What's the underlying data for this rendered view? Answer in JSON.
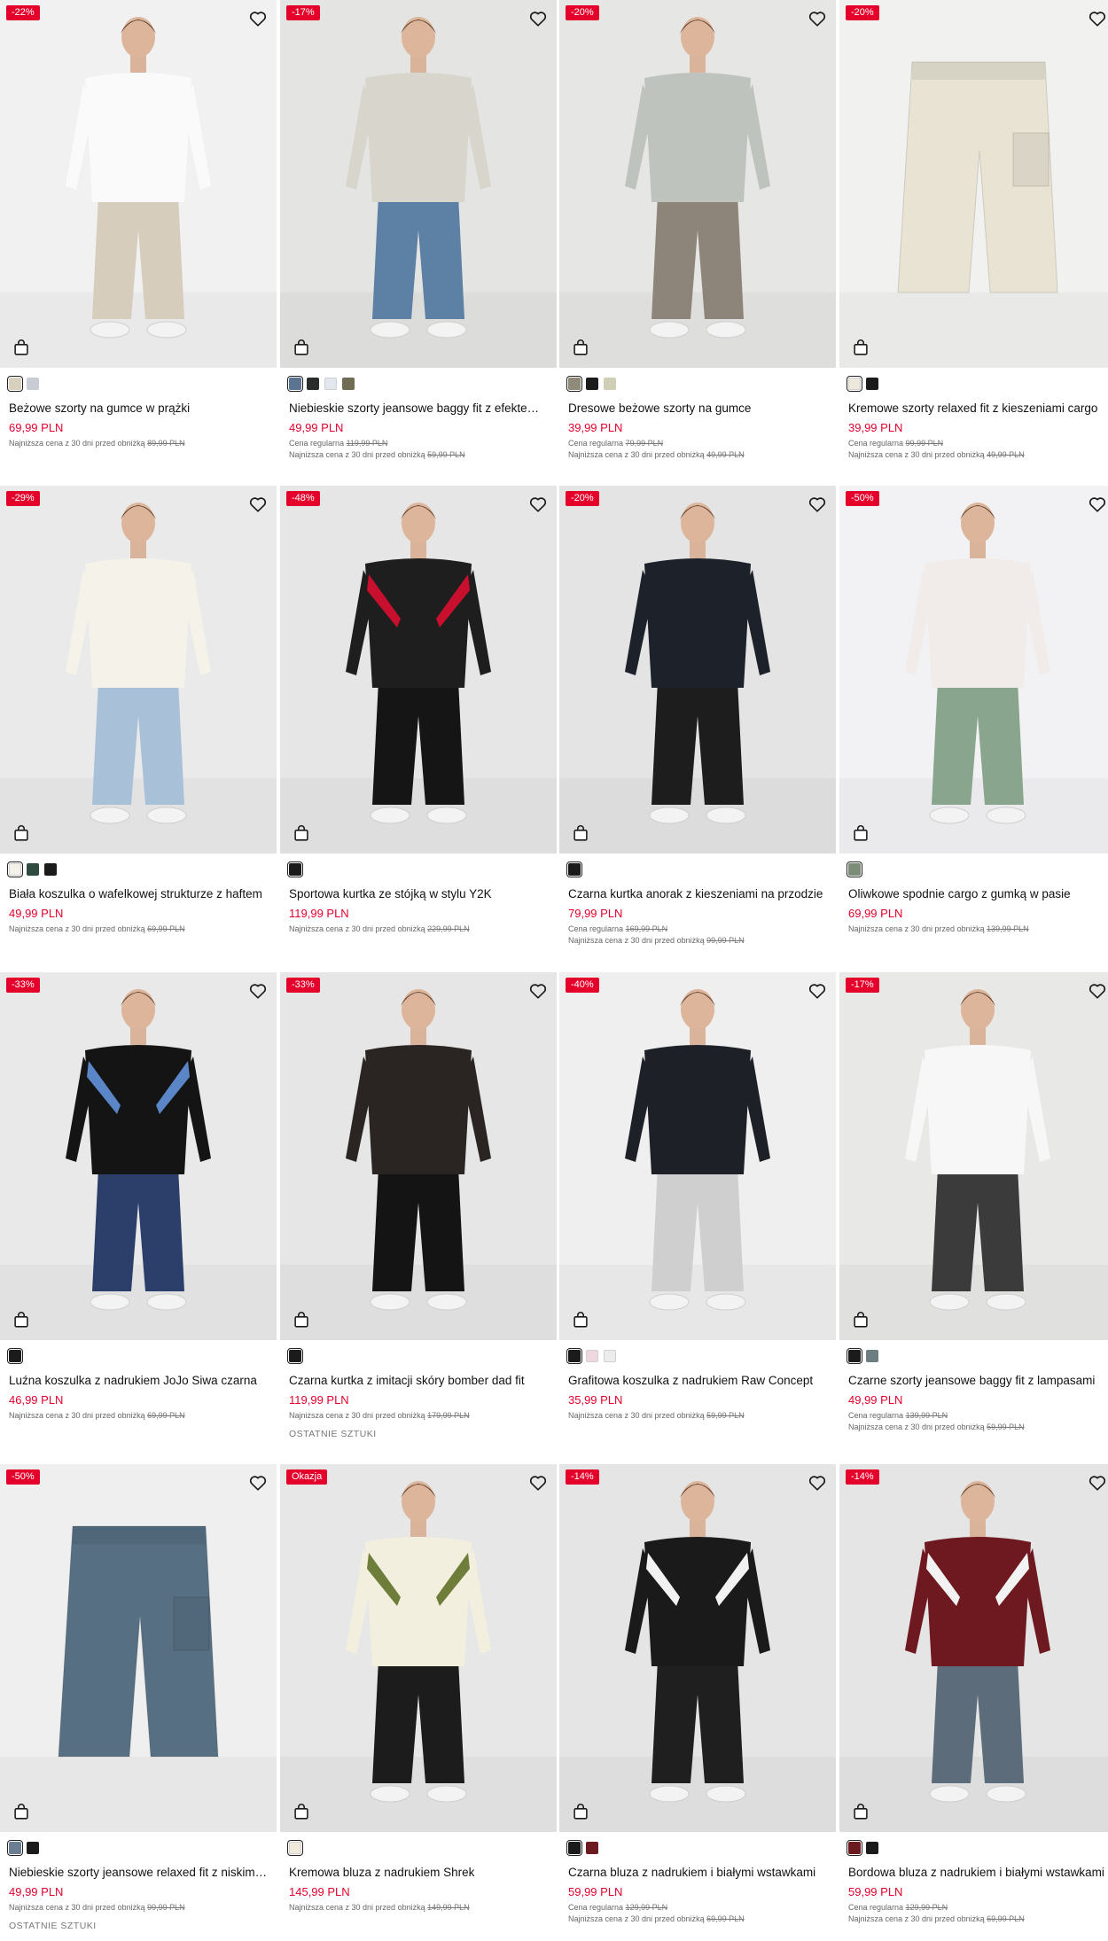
{
  "labels": {
    "lowest_price_prefix": "Najniższa cena z 30 dni przed obniżką",
    "regular_price_prefix": "Cena regularna",
    "last_items": "OSTATNIE SZTUKI"
  },
  "icons": {
    "favorite": "heart-icon",
    "add_to_bag": "shopping-bag-icon"
  },
  "colors": {
    "badge": "#e4002b",
    "price": "#e4002b"
  },
  "products": [
    {
      "badge": "-22%",
      "name": "Beżowe szorty na gumce w prążki",
      "price": "69,99 PLN",
      "regular": null,
      "lowest": "89,99 PLN",
      "last": false,
      "swatches": [
        "#d8cfbd",
        "#c9ccd3"
      ],
      "photo": {
        "bg": "#f1f1f1",
        "top": "#fafafa",
        "bottom": "#d7cdbd",
        "type": "person"
      }
    },
    {
      "badge": "-17%",
      "name": "Niebieskie szorty jeansowe baggy fit z efektem sprania",
      "price": "49,99 PLN",
      "regular": "119,99 PLN",
      "lowest": "59,99 PLN",
      "last": false,
      "swatches": [
        "#5b7590",
        "#2b2d2c",
        "#e2e8ed",
        "#6e6c52"
      ],
      "photo": {
        "bg": "#e4e4e2",
        "top": "#d8d6cc",
        "bottom": "#5d80a5",
        "type": "person"
      }
    },
    {
      "badge": "-20%",
      "name": "Dresowe beżowe szorty na gumce",
      "price": "39,99 PLN",
      "regular": "79,99 PLN",
      "lowest": "49,99 PLN",
      "last": false,
      "swatches": [
        "#8f8a7a",
        "#1b1b1b",
        "#cfcfb5"
      ],
      "photo": {
        "bg": "#e6e6e4",
        "top": "#bfc3bd",
        "bottom": "#8e857a",
        "type": "person"
      }
    },
    {
      "badge": "-20%",
      "name": "Kremowe szorty relaxed fit z kieszeniami cargo",
      "price": "39,99 PLN",
      "regular": "99,99 PLN",
      "lowest": "49,99 PLN",
      "last": false,
      "swatches": [
        "#ece8dc",
        "#1b1b1b"
      ],
      "photo": {
        "bg": "#f1f1ef",
        "top": null,
        "bottom": "#e8e3d3",
        "type": "shorts"
      }
    },
    {
      "badge": "-29%",
      "name": "Biała koszulka o wafelkowej strukturze z haftem",
      "price": "49,99 PLN",
      "regular": null,
      "lowest": "69,99 PLN",
      "last": false,
      "swatches": [
        "#f4f1ea",
        "#2f4b40",
        "#1b1b1b"
      ],
      "photo": {
        "bg": "#eaeaea",
        "top": "#f5f2ea",
        "bottom": "#a9c1d8",
        "type": "person"
      }
    },
    {
      "badge": "-48%",
      "name": "Sportowa kurtka ze stójką w stylu Y2K",
      "price": "119,99 PLN",
      "regular": null,
      "lowest": "229,99 PLN",
      "last": false,
      "swatches": [
        "#1b1b1b"
      ],
      "photo": {
        "bg": "#e6e6e6",
        "top": "#1e1e1e",
        "bottom": "#151515",
        "type": "person",
        "accent": "#c8102e"
      }
    },
    {
      "badge": "-20%",
      "name": "Czarna kurtka anorak z kieszeniami na przodzie",
      "price": "79,99 PLN",
      "regular": "169,99 PLN",
      "lowest": "99,99 PLN",
      "last": false,
      "swatches": [
        "#1b1b1b"
      ],
      "photo": {
        "bg": "#e4e4e4",
        "top": "#1c212a",
        "bottom": "#1d1d1d",
        "type": "person"
      }
    },
    {
      "badge": "-50%",
      "name": "Oliwkowe spodnie cargo z gumką w pasie",
      "price": "69,99 PLN",
      "regular": null,
      "lowest": "139,99 PLN",
      "last": false,
      "swatches": [
        "#7d8c78"
      ],
      "photo": {
        "bg": "#f2f2f4",
        "top": "#f1ecea",
        "bottom": "#8aa58e",
        "type": "person"
      }
    },
    {
      "badge": "-33%",
      "name": "Luźna koszulka z nadrukiem JoJo Siwa czarna",
      "price": "46,99 PLN",
      "regular": null,
      "lowest": "69,99 PLN",
      "last": false,
      "swatches": [
        "#1b1b1b"
      ],
      "photo": {
        "bg": "#e9e9e9",
        "top": "#141414",
        "bottom": "#2c3f6a",
        "type": "person",
        "accent": "#5a86c8"
      }
    },
    {
      "badge": "-33%",
      "name": "Czarna kurtka z imitacji skóry bomber dad fit",
      "price": "119,99 PLN",
      "regular": null,
      "lowest": "179,99 PLN",
      "last": true,
      "swatches": [
        "#1b1b1b"
      ],
      "photo": {
        "bg": "#e6e6e6",
        "top": "#2a2522",
        "bottom": "#141414",
        "type": "person"
      }
    },
    {
      "badge": "-40%",
      "name": "Grafitowa koszulka z nadrukiem Raw Concept",
      "price": "35,99 PLN",
      "regular": null,
      "lowest": "59,99 PLN",
      "last": false,
      "swatches": [
        "#1b1b1b",
        "#f0d6df",
        "#ececec"
      ],
      "photo": {
        "bg": "#efefef",
        "top": "#1d2027",
        "bottom": "#cfcfcf",
        "type": "person"
      }
    },
    {
      "badge": "-17%",
      "name": "Czarne szorty jeansowe baggy fit z lampasami",
      "price": "49,99 PLN",
      "regular": "139,99 PLN",
      "lowest": "59,99 PLN",
      "last": false,
      "swatches": [
        "#1b1b1b",
        "#6d7e80"
      ],
      "photo": {
        "bg": "#e8e8e6",
        "top": "#f7f7f7",
        "bottom": "#3b3b3b",
        "type": "person"
      }
    },
    {
      "badge": "-50%",
      "name": "Niebieskie szorty jeansowe relaxed fit z niskim stanem",
      "price": "49,99 PLN",
      "regular": null,
      "lowest": "99,99 PLN",
      "last": true,
      "swatches": [
        "#6c7f92",
        "#1b1b1b"
      ],
      "photo": {
        "bg": "#efefef",
        "top": null,
        "bottom": "#566f82",
        "type": "shorts"
      }
    },
    {
      "badge": "Okazja",
      "name": "Kremowa bluza z nadrukiem Shrek",
      "price": "145,99 PLN",
      "regular": null,
      "lowest": "149,99 PLN",
      "last": false,
      "swatches": [
        "#efeadb"
      ],
      "photo": {
        "bg": "#e7e7e7",
        "top": "#f2efdf",
        "bottom": "#1c1c1c",
        "type": "person",
        "accent": "#6f7d3a"
      }
    },
    {
      "badge": "-14%",
      "name": "Czarna bluza z nadrukiem i białymi wstawkami",
      "price": "59,99 PLN",
      "regular": "129,99 PLN",
      "lowest": "69,99 PLN",
      "last": false,
      "swatches": [
        "#1b1b1b",
        "#6b1a1f"
      ],
      "photo": {
        "bg": "#e5e5e5",
        "top": "#1a1a1a",
        "bottom": "#1f1f1f",
        "type": "person",
        "accent": "#f2f2f2"
      }
    },
    {
      "badge": "-14%",
      "name": "Bordowa bluza z nadrukiem i białymi wstawkami",
      "price": "59,99 PLN",
      "regular": "129,99 PLN",
      "lowest": "69,99 PLN",
      "last": false,
      "swatches": [
        "#6b1a1f",
        "#1b1b1b"
      ],
      "photo": {
        "bg": "#e5e5e5",
        "top": "#6e1820",
        "bottom": "#5d6c7a",
        "type": "person",
        "accent": "#f2f2f2"
      }
    }
  ]
}
